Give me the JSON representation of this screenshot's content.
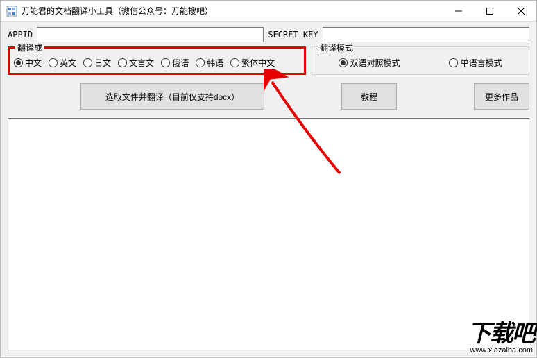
{
  "window": {
    "title": "万能君的文档翻译小工具（微信公众号：万能搜吧）"
  },
  "fields": {
    "appid_label": "APPID",
    "appid_value": "",
    "secret_label": "SECRET KEY",
    "secret_value": ""
  },
  "group_translate_to": {
    "legend": "翻译成",
    "options": [
      {
        "label": "中文",
        "checked": true
      },
      {
        "label": "英文",
        "checked": false
      },
      {
        "label": "日文",
        "checked": false
      },
      {
        "label": "文言文",
        "checked": false
      },
      {
        "label": "俄语",
        "checked": false
      },
      {
        "label": "韩语",
        "checked": false
      },
      {
        "label": "繁体中文",
        "checked": false
      }
    ]
  },
  "group_mode": {
    "legend": "翻译模式",
    "options": [
      {
        "label": "双语对照模式",
        "checked": true
      },
      {
        "label": "单语言模式",
        "checked": false
      }
    ]
  },
  "buttons": {
    "select_translate": "选取文件并翻译（目前仅支持docx）",
    "tutorial": "教程",
    "more_works": "更多作品"
  },
  "output_text": "",
  "watermark": {
    "brand": "下载吧",
    "url": "www.xiazaiba.com"
  }
}
